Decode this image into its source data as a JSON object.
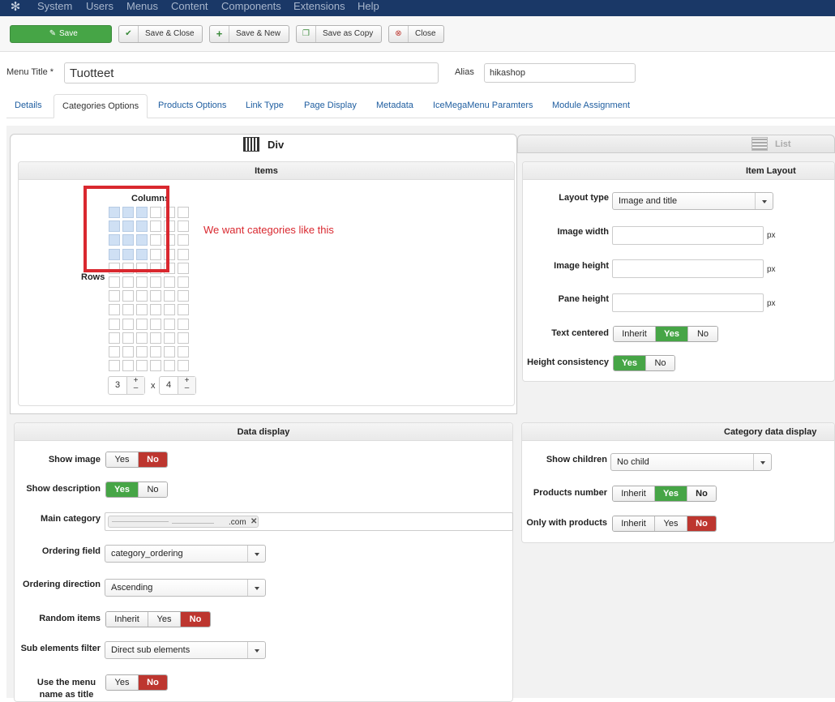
{
  "topmenu": [
    "System",
    "Users",
    "Menus",
    "Content",
    "Components",
    "Extensions",
    "Help"
  ],
  "toolbar": {
    "save": "Save",
    "save_close": "Save & Close",
    "save_new": "Save & New",
    "save_copy": "Save as Copy",
    "close": "Close"
  },
  "form": {
    "menu_title_label": "Menu Title *",
    "menu_title_value": "Tuotteet",
    "alias_label": "Alias",
    "alias_value": "hikashop"
  },
  "tabs": [
    "Details",
    "Categories Options",
    "Products Options",
    "Link Type",
    "Page Display",
    "Metadata",
    "IceMegaMenu Paramters",
    "Module Assignment"
  ],
  "layout_tabs": {
    "div": "Div",
    "list": "List"
  },
  "items_panel": {
    "title": "Items",
    "columns_label": "Columns",
    "rows_label": "Rows",
    "columns_value": "3",
    "x": "x",
    "rows_value": "4",
    "plus": "+",
    "minus": "–",
    "annotation": "We want categories like this",
    "selected_columns": 3,
    "selected_rows": 4,
    "grid_columns": 6,
    "grid_rows": 12
  },
  "item_layout": {
    "title": "Item Layout",
    "layout_type_label": "Layout type",
    "layout_type_value": "Image and title",
    "image_width_label": "Image width",
    "image_height_label": "Image height",
    "pane_height_label": "Pane height",
    "px": "px",
    "text_centered_label": "Text centered",
    "height_consistency_label": "Height consistency"
  },
  "data_display": {
    "title": "Data display",
    "show_image": "Show image",
    "show_description": "Show description",
    "main_category": "Main category",
    "main_category_tag": ".com",
    "ordering_field": "Ordering field",
    "ordering_field_value": "category_ordering",
    "ordering_direction": "Ordering direction",
    "ordering_direction_value": "Ascending",
    "random_items": "Random items",
    "sub_elements_filter": "Sub elements filter",
    "sub_elements_filter_value": "Direct sub elements",
    "use_menu_name": "Use the menu name as title"
  },
  "category_data": {
    "title": "Category data display",
    "show_children": "Show children",
    "show_children_value": "No child",
    "products_number": "Products number",
    "only_with_products": "Only with products"
  },
  "opts": {
    "inherit": "Inherit",
    "yes": "Yes",
    "no": "No"
  },
  "colors": {
    "topbar": "#1a3867",
    "green": "#46a546",
    "red": "#bd362f",
    "annotation": "#d9282f"
  }
}
